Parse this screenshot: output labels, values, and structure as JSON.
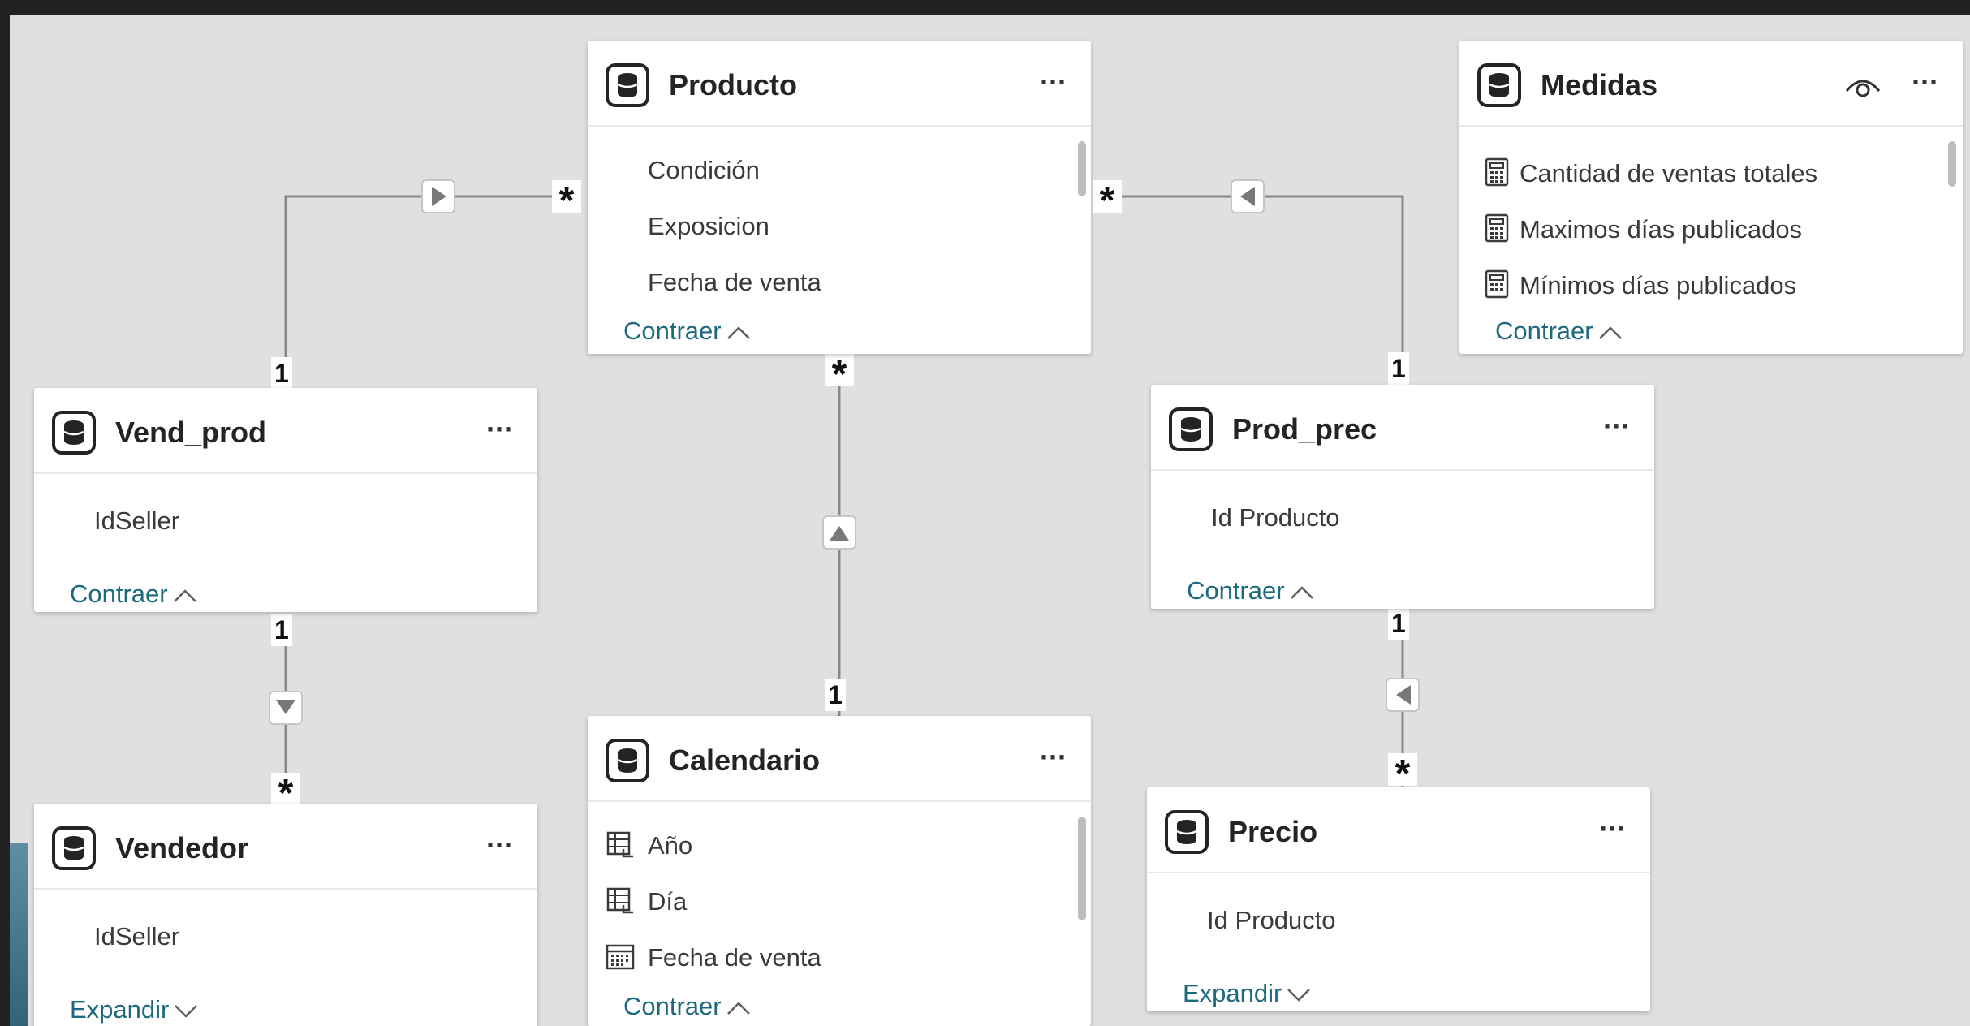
{
  "tables": {
    "producto": {
      "title": "Producto",
      "fields": [
        "Condición",
        "Exposicion",
        "Fecha de venta"
      ],
      "toggle": "Contraer"
    },
    "medidas": {
      "title": "Medidas",
      "fields": [
        "Cantidad de ventas totales",
        "Maximos días publicados",
        "Mínimos días publicados"
      ],
      "toggle": "Contraer",
      "field_icon": "calculator-icon"
    },
    "vend_prod": {
      "title": "Vend_prod",
      "fields": [
        "IdSeller"
      ],
      "toggle": "Contraer"
    },
    "prod_prec": {
      "title": "Prod_prec",
      "fields": [
        "Id Producto"
      ],
      "toggle": "Contraer"
    },
    "vendedor": {
      "title": "Vendedor",
      "fields": [
        "IdSeller"
      ],
      "toggle": "Expandir"
    },
    "calendario": {
      "title": "Calendario",
      "fields": [
        "Año",
        "Día",
        "Fecha de venta"
      ],
      "toggle": "Contraer",
      "field_icons": [
        "hierarchy-icon",
        "hierarchy-icon",
        "calendar-icon"
      ]
    },
    "precio": {
      "title": "Precio",
      "fields": [
        "Id Producto"
      ],
      "toggle": "Expandir"
    }
  },
  "relationships": {
    "one": "1",
    "many": "*"
  },
  "menu_glyph": "···",
  "colors": {
    "canvas": "#e2e0de",
    "card": "#ffffff",
    "toggle_text": "#1d6a7e",
    "line": "#8a8886"
  }
}
